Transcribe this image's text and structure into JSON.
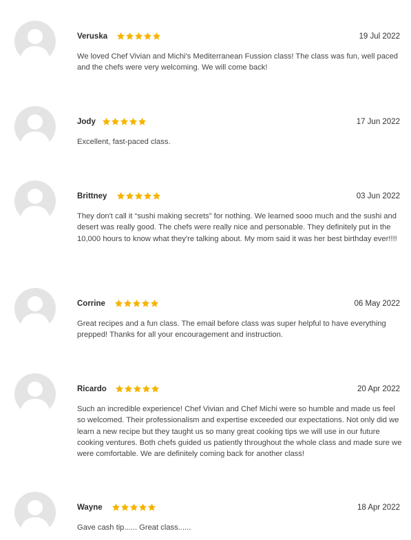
{
  "colors": {
    "star": "#f5b400",
    "avatar_bg": "#e4e4e4",
    "avatar_fg": "#ffffff"
  },
  "icons": {
    "avatar": "default-user-silhouette",
    "star": "filled-star"
  },
  "reviews": [
    {
      "name": "Veruska",
      "rating": 5,
      "date": "19 Jul 2022",
      "text": "We loved Chef Vivian and Michi's Mediterranean Fussion class! The class was fun, well paced and the chefs were very welcoming. We will come back!"
    },
    {
      "name": "Jody",
      "rating": 5,
      "date": "17 Jun 2022",
      "text": "Excellent, fast-paced class."
    },
    {
      "name": "Brittney",
      "rating": 5,
      "date": "03 Jun 2022",
      "text": "They don't call it “sushi making secrets” for nothing. We learned sooo much and the sushi and desert was really good. The chefs were really nice and personable. They definitely put in the 10,000 hours to know what they're talking about. My mom said it was her best birthday ever!!!!"
    },
    {
      "name": "Corrine",
      "rating": 5,
      "date": "06 May 2022",
      "text": "Great recipes and a fun class. The email before class was super helpful to have everything prepped! Thanks for all your encouragement and instruction."
    },
    {
      "name": "Ricardo",
      "rating": 5,
      "date": "20 Apr 2022",
      "text": "Such an incredible experience! Chef Vivian and Chef Michi were so humble and made us feel so welcomed. Their professionalism and expertise exceeded our expectations. Not only did we learn a new recipe but they taught us so many great cooking tips we will use in our future cooking ventures. Both chefs guided us patiently throughout the whole class and made sure we were comfortable. We are definitely coming back for another class!"
    },
    {
      "name": "Wayne",
      "rating": 5,
      "date": "18 Apr 2022",
      "text": "Gave cash tip...... Great class......"
    }
  ]
}
